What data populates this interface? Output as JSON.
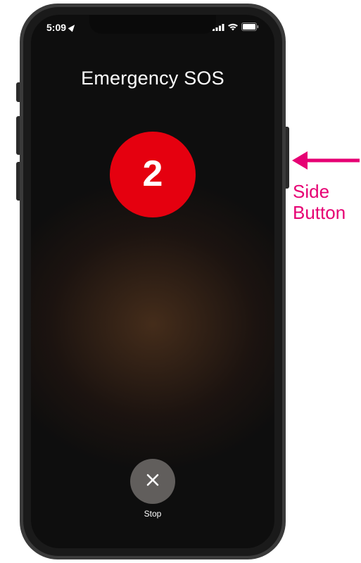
{
  "status": {
    "time": "5:09",
    "locationActive": true
  },
  "title": "Emergency SOS",
  "countdown": "2",
  "stop": {
    "label": "Stop"
  },
  "annotation": {
    "line1": "Side",
    "line2": "Button"
  },
  "colors": {
    "sos": "#e5000f",
    "arrow": "#e60073"
  }
}
